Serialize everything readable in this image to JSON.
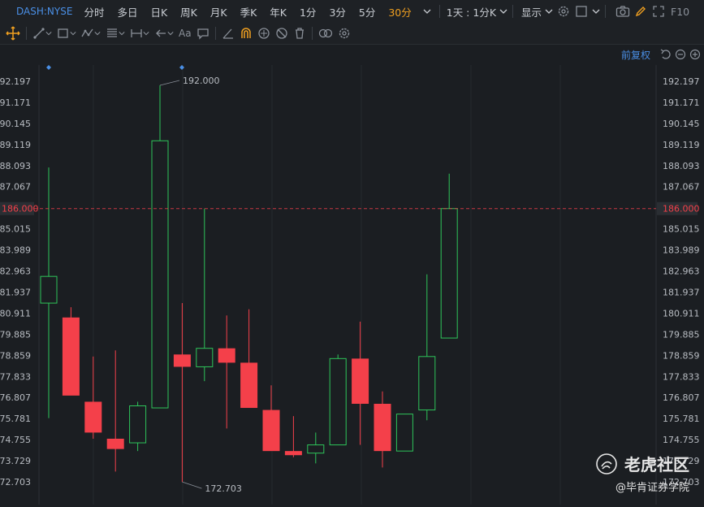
{
  "header": {
    "symbol": "DASH:NYSE",
    "periods": [
      "分时",
      "多日",
      "日K",
      "周K",
      "月K",
      "季K",
      "年K",
      "1分",
      "3分",
      "5分",
      "30分"
    ],
    "active_period": "30分",
    "multi_label": "1天 : 1分K",
    "display_label": "显示",
    "f10_label": "F10"
  },
  "toolbar": {
    "fq_label": "前复权",
    "text_tool_label": "Aa"
  },
  "chart_data": {
    "type": "candlestick",
    "y_ticks": [
      "192.197",
      "191.171",
      "190.145",
      "189.119",
      "188.093",
      "187.067",
      "186.000",
      "185.015",
      "183.989",
      "182.963",
      "181.937",
      "180.911",
      "179.885",
      "178.859",
      "177.833",
      "176.807",
      "175.781",
      "174.755",
      "173.729",
      "172.703"
    ],
    "tick_values": [
      192.197,
      191.171,
      190.145,
      189.119,
      188.093,
      187.067,
      186.0,
      185.015,
      183.989,
      182.963,
      181.937,
      180.911,
      179.885,
      178.859,
      177.833,
      176.807,
      175.781,
      174.755,
      173.729,
      172.703
    ],
    "current_price": "186.000",
    "current_value": 186.0,
    "high_label": "192.000",
    "low_label": "172.703",
    "candles": [
      {
        "o": 181.4,
        "h": 188.0,
        "l": 175.8,
        "c": 182.7
      },
      {
        "o": 180.7,
        "h": 181.2,
        "l": 177.0,
        "c": 176.9
      },
      {
        "o": 176.6,
        "h": 178.8,
        "l": 174.8,
        "c": 175.1
      },
      {
        "o": 174.8,
        "h": 179.1,
        "l": 173.2,
        "c": 174.3
      },
      {
        "o": 174.6,
        "h": 176.6,
        "l": 174.2,
        "c": 176.4
      },
      {
        "o": 176.3,
        "h": 192.0,
        "l": 176.3,
        "c": 189.3
      },
      {
        "o": 178.9,
        "h": 181.4,
        "l": 172.7,
        "c": 178.3
      },
      {
        "o": 178.3,
        "h": 186.0,
        "l": 177.6,
        "c": 179.2
      },
      {
        "o": 179.2,
        "h": 180.8,
        "l": 175.3,
        "c": 178.5
      },
      {
        "o": 178.5,
        "h": 181.1,
        "l": 176.6,
        "c": 176.3
      },
      {
        "o": 176.2,
        "h": 177.4,
        "l": 174.3,
        "c": 174.2
      },
      {
        "o": 174.2,
        "h": 175.9,
        "l": 173.9,
        "c": 174.0
      },
      {
        "o": 174.1,
        "h": 175.1,
        "l": 173.6,
        "c": 174.5
      },
      {
        "o": 174.5,
        "h": 178.9,
        "l": 174.5,
        "c": 178.7
      },
      {
        "o": 178.7,
        "h": 180.5,
        "l": 174.5,
        "c": 176.5
      },
      {
        "o": 176.5,
        "h": 177.1,
        "l": 173.4,
        "c": 174.2
      },
      {
        "o": 174.2,
        "h": 176.0,
        "l": 174.2,
        "c": 176.0
      },
      {
        "o": 176.2,
        "h": 182.8,
        "l": 175.7,
        "c": 178.8
      },
      {
        "o": 179.7,
        "h": 187.7,
        "l": 179.7,
        "c": 186.0
      }
    ]
  },
  "watermark": {
    "brand": "老虎社区",
    "author": "@毕肯证券学院"
  },
  "colors": {
    "up": "#f4404a",
    "down": "#2ec45a",
    "accent": "#4a8fe6",
    "active": "#f0a020",
    "price_line": "#f4404a"
  }
}
